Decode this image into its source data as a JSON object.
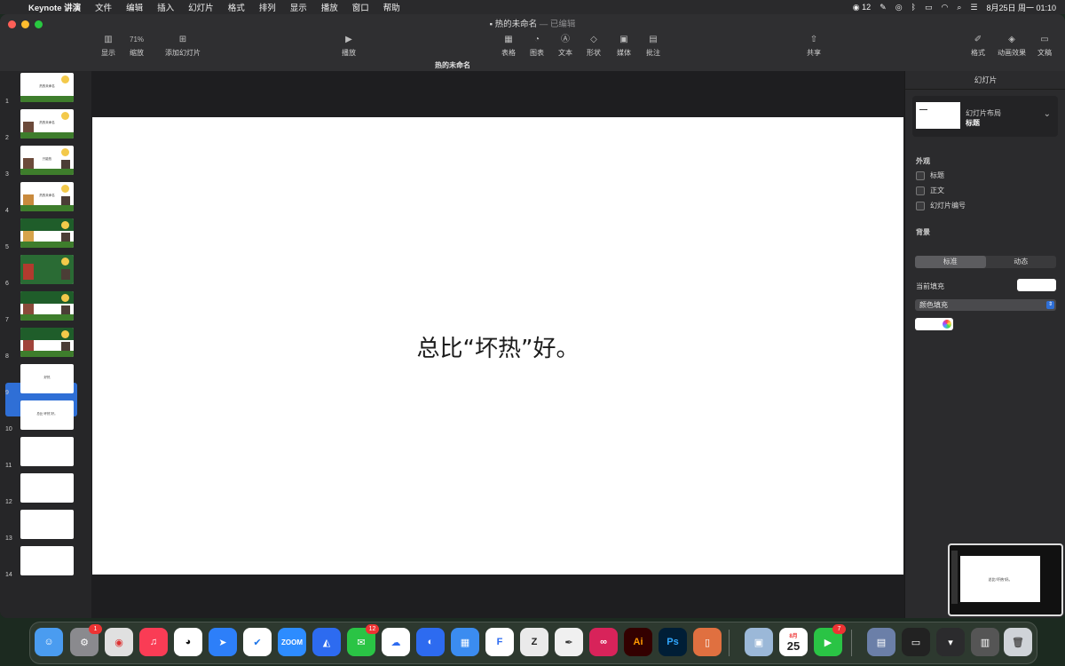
{
  "menubar": {
    "app_name": "Keynote 讲演",
    "items": [
      "文件",
      "编辑",
      "插入",
      "幻灯片",
      "格式",
      "排列",
      "显示",
      "播放",
      "窗口",
      "帮助"
    ],
    "wechat_count": "12",
    "datetime": "8月25日 周一 01:10"
  },
  "window": {
    "title": "热的未命名",
    "title_status": "— 已编辑",
    "subtitle": "热的未命名"
  },
  "toolbar": {
    "view_label": "显示",
    "zoom_value": "71%",
    "zoom_label": "缩放",
    "add_slide_label": "添加幻灯片",
    "play_label": "播放",
    "table_label": "表格",
    "chart_label": "图表",
    "text_label": "文本",
    "shape_label": "形状",
    "media_label": "媒体",
    "comment_label": "批注",
    "share_label": "共享",
    "format_label": "格式",
    "animate_label": "动画效果",
    "document_label": "文稿"
  },
  "slides": [
    {
      "num": "1",
      "title": "热的未命名"
    },
    {
      "num": "2",
      "title": "热的未命名"
    },
    {
      "num": "3",
      "title": "只能热"
    },
    {
      "num": "4",
      "title": "热的未命名"
    },
    {
      "num": "5",
      "title": ""
    },
    {
      "num": "6",
      "title": ""
    },
    {
      "num": "7",
      "title": ""
    },
    {
      "num": "8",
      "title": ""
    },
    {
      "num": "9",
      "title": "好热"
    },
    {
      "num": "10",
      "title": "总比“坏热”好。"
    },
    {
      "num": "11",
      "title": ""
    },
    {
      "num": "12",
      "title": ""
    },
    {
      "num": "13",
      "title": ""
    },
    {
      "num": "14",
      "title": ""
    }
  ],
  "slide_canvas": {
    "text": "总比“坏热”好。"
  },
  "inspector": {
    "header": "幻灯片",
    "layout_label": "幻灯片布局",
    "layout_value": "标题",
    "appearance_title": "外观",
    "checkboxes": [
      "标题",
      "正文",
      "幻灯片编号"
    ],
    "background_title": "背景",
    "seg_standard": "标准",
    "seg_dynamic": "动态",
    "current_fill_label": "当前填充",
    "fill_type": "颜色填充"
  },
  "dock": {
    "settings_badge": "1",
    "wechat_badge": "12",
    "facetime_badge": "7",
    "calendar_month": "8月",
    "calendar_day": "25",
    "zoom_label": "ZOOM",
    "ai_label": "Ai",
    "ps_label": "Ps"
  }
}
